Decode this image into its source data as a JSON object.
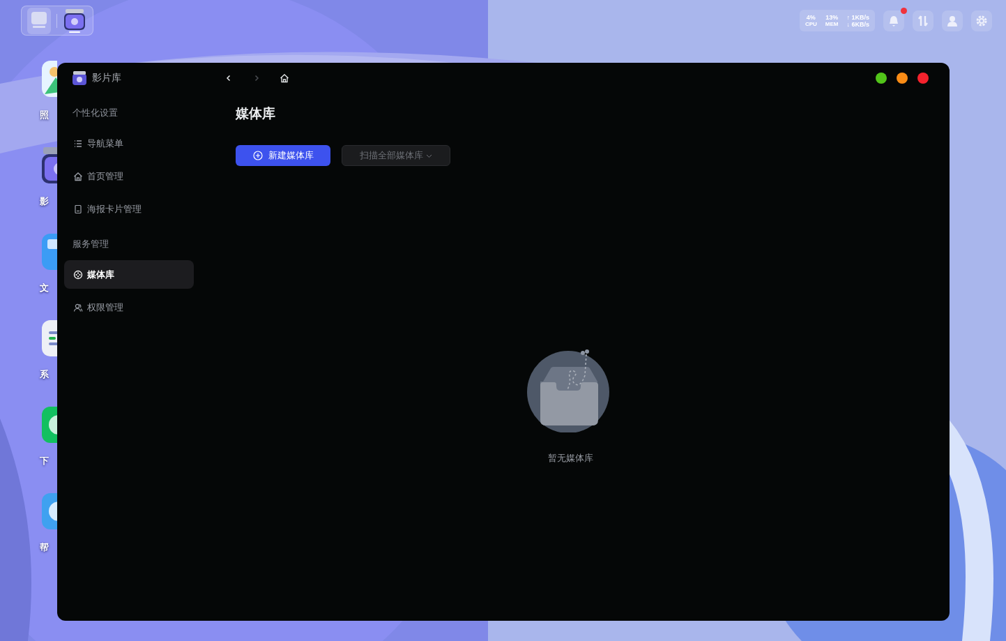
{
  "desktop": {
    "icons": [
      {
        "kind": "photos",
        "label": "照"
      },
      {
        "kind": "video",
        "label": "影"
      },
      {
        "kind": "folder",
        "label": "文"
      },
      {
        "kind": "system",
        "label": "系"
      },
      {
        "kind": "download",
        "label": "下"
      },
      {
        "kind": "help",
        "label": "帮"
      }
    ]
  },
  "top_dock": {
    "apps": [
      {
        "kind": "desktop",
        "selected": false
      },
      {
        "kind": "video",
        "selected": true
      }
    ]
  },
  "status_area": {
    "cpu": "4%",
    "cpu_label": "CPU",
    "mem": "13%",
    "mem_label": "MEM",
    "upload": "↑ 1KB/s",
    "download": "↓ 6KB/s",
    "unread_notifications": true
  },
  "window": {
    "title": "影片库",
    "controls": [
      {
        "color": "#52c41a"
      },
      {
        "color": "#fa8c16"
      },
      {
        "color": "#f5222d"
      }
    ],
    "nav": {
      "back_disabled": false,
      "forward_disabled": true
    },
    "sidebar": {
      "groups": [
        {
          "heading": "个性化设置",
          "items": [
            {
              "kind": "list",
              "label": "导航菜单",
              "selected": false
            },
            {
              "kind": "home",
              "label": "首页管理",
              "selected": false
            },
            {
              "kind": "poster",
              "label": "海报卡片管理",
              "selected": false
            }
          ]
        },
        {
          "heading": "服务管理",
          "items": [
            {
              "kind": "film",
              "label": "媒体库",
              "selected": true
            },
            {
              "kind": "users",
              "label": "权限管理",
              "selected": false
            }
          ]
        }
      ]
    },
    "page": {
      "title": "媒体库",
      "buttons": [
        {
          "kind": "primary",
          "label": "新建媒体库"
        },
        {
          "kind": "dropdown",
          "label": "扫描全部媒体库"
        }
      ],
      "empty_state": {
        "message": "暂无媒体库"
      }
    }
  }
}
